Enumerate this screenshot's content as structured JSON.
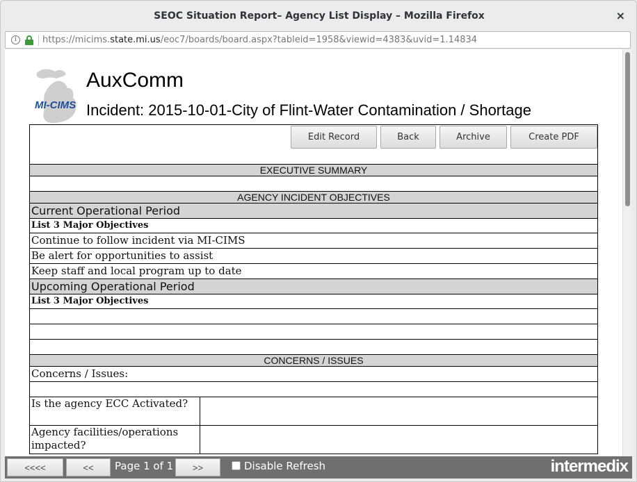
{
  "window": {
    "title": "SEOC Situation Report– Agency List Display – Mozilla Firefox",
    "close_glyph": "×"
  },
  "urlbar": {
    "prefix": "https://micims.",
    "domain": "state.mi.us",
    "path": "/eoc7/boards/board.aspx?tableid=1958&viewid=4383&uvid=1.14834",
    "info_glyph": "i"
  },
  "header": {
    "logo_text": "MI-CIMS",
    "app_name": "AuxComm",
    "incident": "Incident: 2015-10-01-City of Flint-Water Contamination / Shortage"
  },
  "toolbar": {
    "edit_label": "Edit Record",
    "back_label": "Back",
    "archive_label": "Archive",
    "pdf_label": "Create PDF"
  },
  "report": {
    "exec_summary": "EXECUTIVE SUMMARY",
    "objectives_header": "AGENCY INCIDENT OBJECTIVES",
    "current_period": "Current Operational Period",
    "current_list_label": "List 3 Major Objectives",
    "current_objectives": [
      "Continue to follow incident via MI-CIMS",
      "Be alert for opportunities to assist",
      "Keep staff and local program up to date"
    ],
    "upcoming_period": "Upcoming Operational Period",
    "upcoming_list_label": "List 3 Major Objectives",
    "upcoming_objectives": [
      "",
      "",
      ""
    ],
    "concerns_header": "CONCERNS / ISSUES",
    "concerns_label": "Concerns / Issues:",
    "concerns_value": "",
    "ecc_label": "Is the agency ECC Activated?",
    "ecc_value": "",
    "facilities_label": "Agency facilities/operations impacted?",
    "facilities_value": ""
  },
  "statusbar": {
    "first_label": "<<<<",
    "prev_label": "<<",
    "page_text": "Page 1 of 1",
    "next_label": ">>",
    "disable_refresh_label": "Disable Refresh",
    "disable_refresh_checked": false,
    "brand": "intermedix"
  },
  "colors": {
    "section_bg": "#d4d4d4",
    "statusbar_bg": "#6f6f6f",
    "lock_green": "#3c9a3c",
    "logo_blue": "#1f4e99"
  }
}
